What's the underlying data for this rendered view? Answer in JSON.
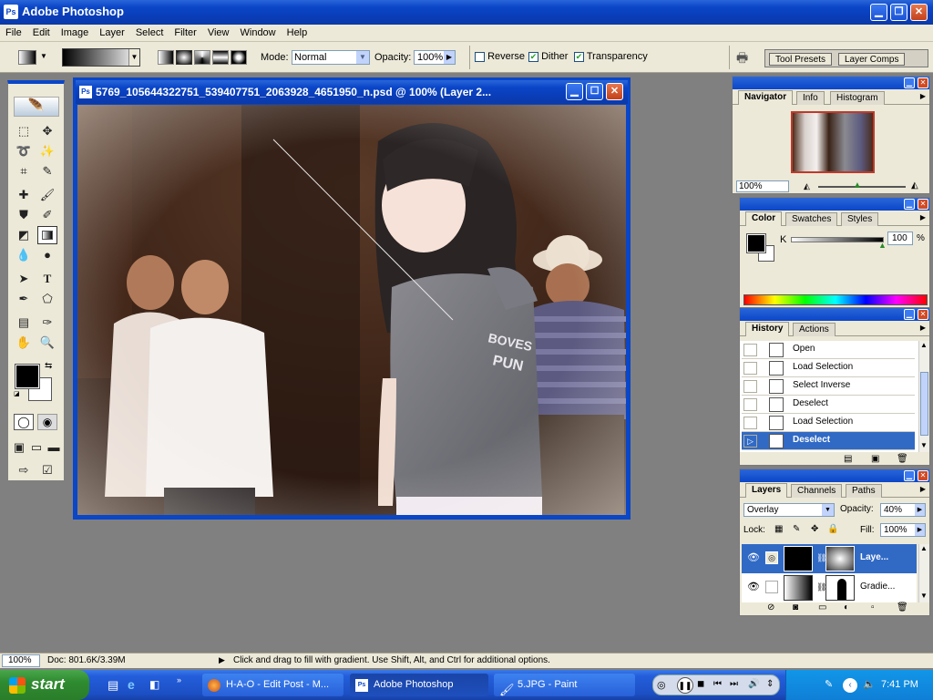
{
  "app": {
    "title": "Adobe Photoshop"
  },
  "menu": [
    "File",
    "Edit",
    "Image",
    "Layer",
    "Select",
    "Filter",
    "View",
    "Window",
    "Help"
  ],
  "options": {
    "mode_label": "Mode:",
    "mode_value": "Normal",
    "opacity_label": "Opacity:",
    "opacity_value": "100%",
    "reverse": "Reverse",
    "dither": "Dither",
    "transparency": "Transparency",
    "reverse_checked": false,
    "dither_checked": true,
    "transparency_checked": true,
    "tool_presets": "Tool Presets",
    "layer_comps": "Layer Comps"
  },
  "document": {
    "title": "5769_105644322751_539407751_2063928_4651950_n.psd @ 100% (Layer 2..."
  },
  "navigator": {
    "tabs": [
      "Navigator",
      "Info",
      "Histogram"
    ],
    "zoom": "100%"
  },
  "color": {
    "tabs": [
      "Color",
      "Swatches",
      "Styles"
    ],
    "channel": "K",
    "value": "100",
    "unit": "%",
    "slider_fraction": 1.0
  },
  "history": {
    "tabs": [
      "History",
      "Actions"
    ],
    "items": [
      "Open",
      "Load Selection",
      "Select Inverse",
      "Deselect",
      "Load Selection",
      "Deselect"
    ],
    "selected_index": 5
  },
  "layers": {
    "tabs": [
      "Layers",
      "Channels",
      "Paths"
    ],
    "blend_mode": "Overlay",
    "opacity_label": "Opacity:",
    "opacity": "40%",
    "lock_label": "Lock:",
    "fill_label": "Fill:",
    "fill": "100%",
    "items": [
      {
        "name": "Laye...",
        "selected": true
      },
      {
        "name": "Gradie...",
        "selected": false
      }
    ]
  },
  "status": {
    "zoom": "100%",
    "doc": "Doc: 801.6K/3.39M",
    "hint": "Click and drag to fill with gradient.  Use Shift, Alt, and Ctrl for additional options."
  },
  "taskbar": {
    "start": "start",
    "tasks": [
      {
        "label": "H-A-O - Edit Post - M..."
      },
      {
        "label": "Adobe Photoshop"
      },
      {
        "label": "5.JPG - Paint"
      }
    ],
    "clock": "7:41 PM"
  },
  "colors": {
    "xp_blue": "#0a46c8",
    "panel_bg": "#ece9d8",
    "selection": "#316ac5"
  }
}
